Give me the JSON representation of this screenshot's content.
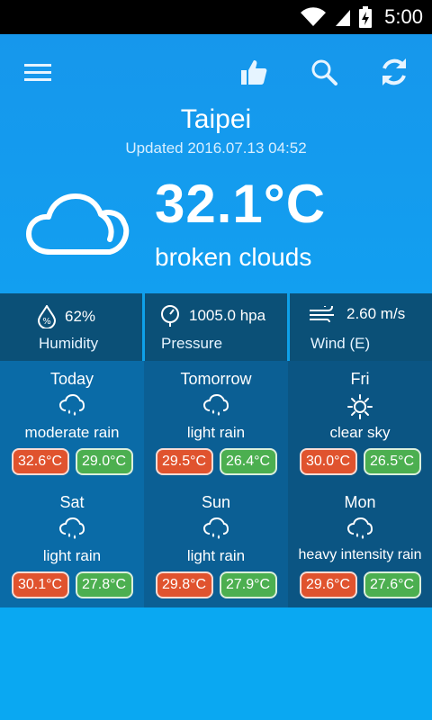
{
  "status": {
    "time": "5:00"
  },
  "header": {
    "city": "Taipei",
    "updated": "Updated 2016.07.13 04:52"
  },
  "current": {
    "temperature": "32.1°C",
    "description": "broken clouds",
    "icon": "cloud-icon"
  },
  "stats": {
    "humidity": {
      "value": "62%",
      "label": "Humidity",
      "icon": "humidity-icon"
    },
    "pressure": {
      "value": "1005.0 hpa",
      "label": "Pressure",
      "icon": "pressure-gauge-icon"
    },
    "wind": {
      "value": "2.60 m/s",
      "label": "Wind (E)",
      "icon": "wind-icon"
    }
  },
  "forecast": [
    {
      "day": "Today",
      "desc": "moderate rain",
      "max": "32.6°C",
      "min": "29.0°C",
      "icon": "rain-cloud-icon"
    },
    {
      "day": "Tomorrow",
      "desc": "light rain",
      "max": "29.5°C",
      "min": "26.4°C",
      "icon": "rain-cloud-icon"
    },
    {
      "day": "Fri",
      "desc": "clear sky",
      "max": "30.0°C",
      "min": "26.5°C",
      "icon": "sun-icon"
    },
    {
      "day": "Sat",
      "desc": "light rain",
      "max": "30.1°C",
      "min": "27.8°C",
      "icon": "rain-cloud-icon"
    },
    {
      "day": "Sun",
      "desc": "light rain",
      "max": "29.8°C",
      "min": "27.9°C",
      "icon": "rain-cloud-icon"
    },
    {
      "day": "Mon",
      "desc": "heavy intensity rain",
      "max": "29.6°C",
      "min": "27.6°C",
      "icon": "rain-cloud-icon"
    }
  ],
  "colors": {
    "header_bg": "#1697ec",
    "stats_bg": "#0b5077",
    "max_badge": "#e0532e",
    "min_badge": "#4caf50"
  }
}
